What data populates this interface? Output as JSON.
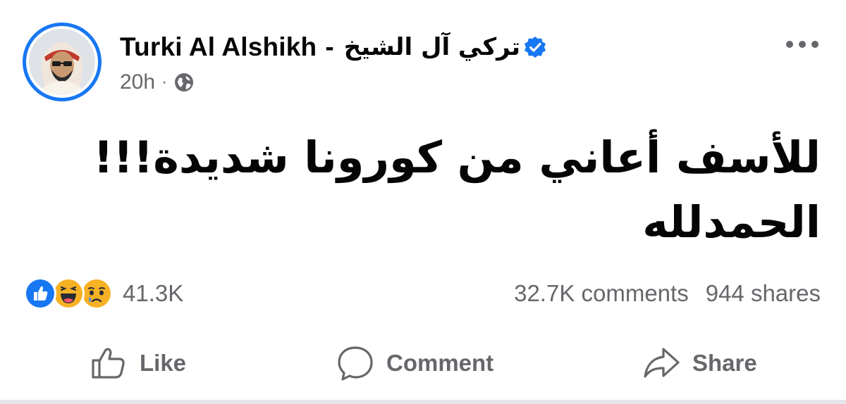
{
  "post": {
    "author": {
      "name_latin": "Turki Al Alshikh",
      "separator": "-",
      "name_arabic": "تركي آل الشيخ",
      "verified_icon": "verified-badge-icon",
      "avatar_icon": "profile-avatar"
    },
    "meta": {
      "timestamp": "20h",
      "dot": "·",
      "audience_icon": "globe-icon"
    },
    "more_icon": "more-options-icon",
    "text_lines": [
      "للأسف أعاني من كورونا شديدة!!!",
      "الحمدلله"
    ],
    "stats": {
      "reaction_icons": [
        "like",
        "haha",
        "sad"
      ],
      "reaction_count": "41.3K",
      "comments": "32.7K comments",
      "shares": "944 shares"
    },
    "actions": {
      "like_label": "Like",
      "comment_label": "Comment",
      "share_label": "Share"
    },
    "colors": {
      "accent": "#1877f2",
      "secondary_text": "#65676b",
      "primary_text": "#050505",
      "reaction_yellow": "#f7b125"
    }
  }
}
